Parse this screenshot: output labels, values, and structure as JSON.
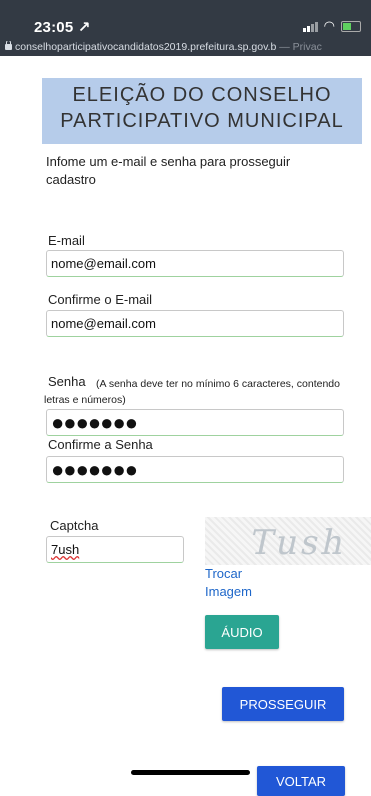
{
  "status_bar": {
    "time": "23:05",
    "location_arrow": "↗"
  },
  "browser": {
    "url_host": "conselhoparticipativocandidatos2019.prefeitura.sp.gov.b",
    "url_suffix": " — Privac"
  },
  "header": {
    "title_line1": "ELEIÇÃO DO CONSELHO",
    "title_line2": "PARTICIPATIVO MUNICIPAL",
    "background": "#b6ccea"
  },
  "intro": "Infome um e-mail e senha para prosseguir cadastro",
  "form": {
    "email_label": "E-mail",
    "email_value": "nome@email.com",
    "confirm_email_label": "Confirme o E-mail",
    "confirm_email_value": "nome@email.com",
    "password_label": "Senha",
    "password_hint": "(A senha deve ter no mínimo 6 caracteres, contendo letras e números)",
    "password_value": "●●●●●●●",
    "confirm_password_label": "Confirme a Senha",
    "confirm_password_value": "●●●●●●●",
    "captcha_label": "Captcha",
    "captcha_value": "7ush",
    "captcha_image_text": "Tush"
  },
  "links": {
    "swap_image_line1": "Trocar",
    "swap_image_line2": "Imagem"
  },
  "buttons": {
    "audio": "ÁUDIO",
    "proceed": "PROSSEGUIR",
    "back": "VOLTAR"
  },
  "colors": {
    "audio_button": "#2aa592",
    "primary_button": "#2157d6",
    "link": "#1d66c9"
  }
}
